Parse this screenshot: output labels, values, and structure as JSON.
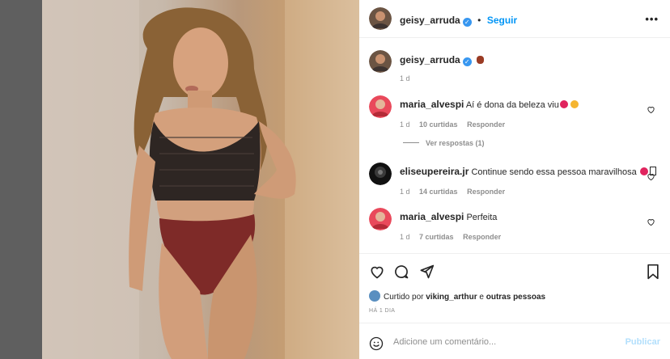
{
  "post": {
    "author": "geisy_arruda",
    "follow_label": "Seguir",
    "more_icon": "more-horizontal-icon",
    "caption_time": "1 d"
  },
  "comments": [
    {
      "user": "maria_alvespi",
      "text": "Aí é dona da beleza viu",
      "time": "1 d",
      "likes": "10 curtidas",
      "reply": "Responder",
      "view_replies": "Ver respostas (1)"
    },
    {
      "user": "eliseupereira.jr",
      "text": "Continue sendo essa pessoa maravilhosa",
      "time": "1 d",
      "likes": "14 curtidas",
      "reply": "Responder"
    },
    {
      "user": "maria_alvespi",
      "text": "Perfeita",
      "time": "1 d",
      "likes": "7 curtidas",
      "reply": "Responder"
    }
  ],
  "liked_by": {
    "prefix": "Curtido por",
    "user": "viking_arthur",
    "connector": "e",
    "others": "outras pessoas"
  },
  "time_ago": "HÁ 1 DIA",
  "add_comment": {
    "placeholder": "Adicione um comentário...",
    "publish_label": "Publicar"
  },
  "colors": {
    "accent": "#0095f6",
    "verified": "#3897f0",
    "publish_disabled": "#b2dffc",
    "heart_red": "#ed4956"
  }
}
